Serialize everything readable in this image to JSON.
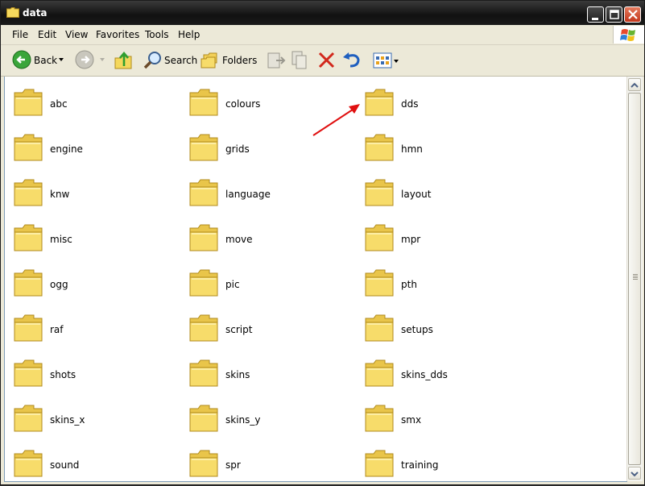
{
  "window": {
    "title": "data"
  },
  "menu": [
    "File",
    "Edit",
    "View",
    "Favorites",
    "Tools",
    "Help"
  ],
  "toolbar": {
    "back_label": "Back",
    "search_label": "Search",
    "folders_label": "Folders"
  },
  "folders": [
    "abc",
    "colours",
    "dds",
    "engine",
    "grids",
    "hmn",
    "knw",
    "language",
    "layout",
    "misc",
    "move",
    "mpr",
    "ogg",
    "pic",
    "pth",
    "raf",
    "script",
    "setups",
    "shots",
    "skins",
    "skins_dds",
    "skins_x",
    "skins_y",
    "smx",
    "sound",
    "spr",
    "training"
  ],
  "annotation": {
    "arrow_color": "#e01010",
    "points_to": "dds"
  },
  "colors": {
    "folder_fill": "#f7dc6a",
    "titlebar": "#1a1a1a",
    "chrome": "#ece9d8"
  }
}
